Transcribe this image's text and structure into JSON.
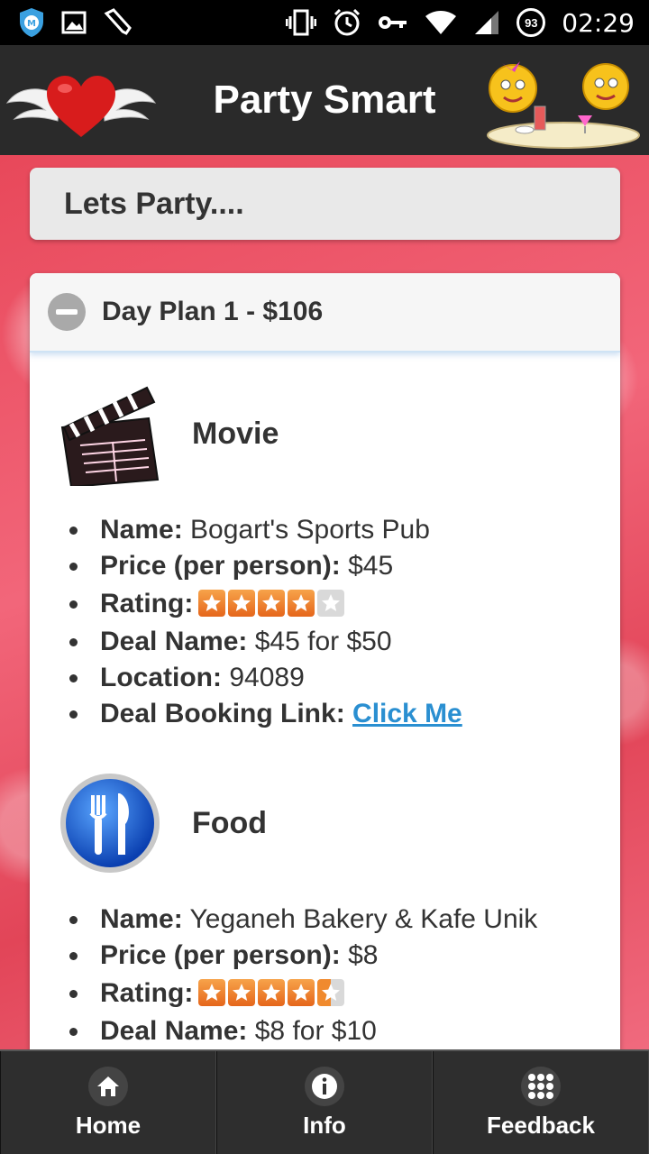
{
  "status_bar": {
    "time": "02:29",
    "battery_level": "93",
    "icons": [
      "shield-icon",
      "image-icon",
      "tool-icon",
      "vibrate-icon",
      "alarm-icon",
      "key-icon",
      "wifi-icon",
      "signal-icon"
    ]
  },
  "header": {
    "title": "Party Smart",
    "logo_left": "winged-heart-logo",
    "logo_right": "smiley-party-logo"
  },
  "lets_party_label": "Lets Party....",
  "plan": {
    "title": "Day Plan 1 - $106",
    "sections": [
      {
        "title": "Movie",
        "icon": "clapperboard-icon",
        "details": {
          "name_label": "Name:",
          "name": "Bogart's Sports Pub",
          "price_label": "Price (per person):",
          "price": "$45",
          "rating_label": "Rating:",
          "rating": 4,
          "rating_max": 5,
          "deal_label": "Deal Name:",
          "deal": "$45 for $50",
          "location_label": "Location:",
          "location": "94089",
          "link_label": "Deal Booking Link:",
          "link_text": "Click Me"
        }
      },
      {
        "title": "Food",
        "icon": "fork-knife-icon",
        "details": {
          "name_label": "Name:",
          "name": "Yeganeh Bakery & Kafe Unik",
          "price_label": "Price (per person):",
          "price": "$8",
          "rating_label": "Rating:",
          "rating": 4.5,
          "rating_max": 5,
          "deal_label": "Deal Name:",
          "deal": "$8 for $10"
        }
      }
    ]
  },
  "nav": [
    {
      "label": "Home",
      "icon": "home-icon"
    },
    {
      "label": "Info",
      "icon": "info-icon"
    },
    {
      "label": "Feedback",
      "icon": "grid-icon"
    }
  ],
  "colors": {
    "header_bg": "#2a2a2a",
    "content_bg": "#e8485a",
    "link": "#2a8fd1",
    "star_on": "#f08a2e"
  }
}
